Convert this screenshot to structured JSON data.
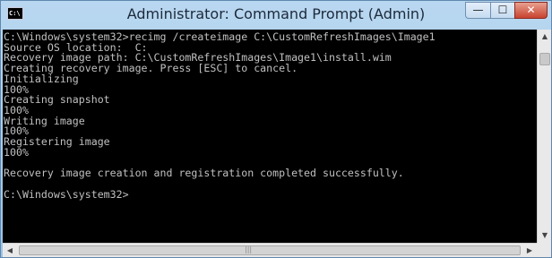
{
  "window": {
    "title": "Administrator: Command Prompt (Admin)",
    "icon_label": "C:\\",
    "controls": {
      "minimize": "—",
      "maximize": "☐",
      "close": "✕"
    }
  },
  "console": {
    "lines": [
      "C:\\Windows\\system32>recimg /createimage C:\\CustomRefreshImages\\Image1",
      "Source OS location:  C:",
      "Recovery image path: C:\\CustomRefreshImages\\Image1\\install.wim",
      "Creating recovery image. Press [ESC] to cancel.",
      "Initializing",
      "100%",
      "Creating snapshot",
      "100%",
      "Writing image",
      "100%",
      "Registering image",
      "100%",
      "",
      "Recovery image creation and registration completed successfully.",
      "",
      "C:\\Windows\\system32>"
    ]
  },
  "scrollbar": {
    "up": "▲",
    "down": "▼",
    "left": "◀",
    "right": "▶",
    "grip": "|||"
  },
  "colors": {
    "console_bg": "#000000",
    "console_text": "#c0c0c0",
    "title_bar": "#b9d7f0",
    "close": "#c8432f"
  }
}
